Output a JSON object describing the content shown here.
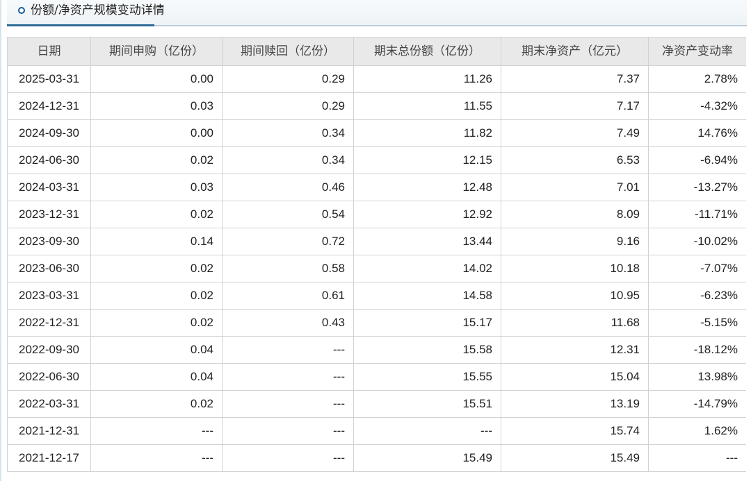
{
  "section": {
    "title": "份额/净资产规模变动详情"
  },
  "table": {
    "headers": [
      "日期",
      "期间申购（亿份）",
      "期间赎回（亿份）",
      "期末总份额（亿份）",
      "期末净资产（亿元）",
      "净资产变动率"
    ],
    "rows": [
      [
        "2025-03-31",
        "0.00",
        "0.29",
        "11.26",
        "7.37",
        "2.78%"
      ],
      [
        "2024-12-31",
        "0.03",
        "0.29",
        "11.55",
        "7.17",
        "-4.32%"
      ],
      [
        "2024-09-30",
        "0.00",
        "0.34",
        "11.82",
        "7.49",
        "14.76%"
      ],
      [
        "2024-06-30",
        "0.02",
        "0.34",
        "12.15",
        "6.53",
        "-6.94%"
      ],
      [
        "2024-03-31",
        "0.03",
        "0.46",
        "12.48",
        "7.01",
        "-13.27%"
      ],
      [
        "2023-12-31",
        "0.02",
        "0.54",
        "12.92",
        "8.09",
        "-11.71%"
      ],
      [
        "2023-09-30",
        "0.14",
        "0.72",
        "13.44",
        "9.16",
        "-10.02%"
      ],
      [
        "2023-06-30",
        "0.02",
        "0.58",
        "14.02",
        "10.18",
        "-7.07%"
      ],
      [
        "2023-03-31",
        "0.02",
        "0.61",
        "14.58",
        "10.95",
        "-6.23%"
      ],
      [
        "2022-12-31",
        "0.02",
        "0.43",
        "15.17",
        "11.68",
        "-5.15%"
      ],
      [
        "2022-09-30",
        "0.04",
        "---",
        "15.58",
        "12.31",
        "-18.12%"
      ],
      [
        "2022-06-30",
        "0.04",
        "---",
        "15.55",
        "15.04",
        "13.98%"
      ],
      [
        "2022-03-31",
        "0.02",
        "---",
        "15.51",
        "13.19",
        "-14.79%"
      ],
      [
        "2021-12-31",
        "---",
        "---",
        "---",
        "15.74",
        "1.62%"
      ],
      [
        "2021-12-17",
        "---",
        "---",
        "15.49",
        "15.49",
        "---"
      ]
    ]
  }
}
